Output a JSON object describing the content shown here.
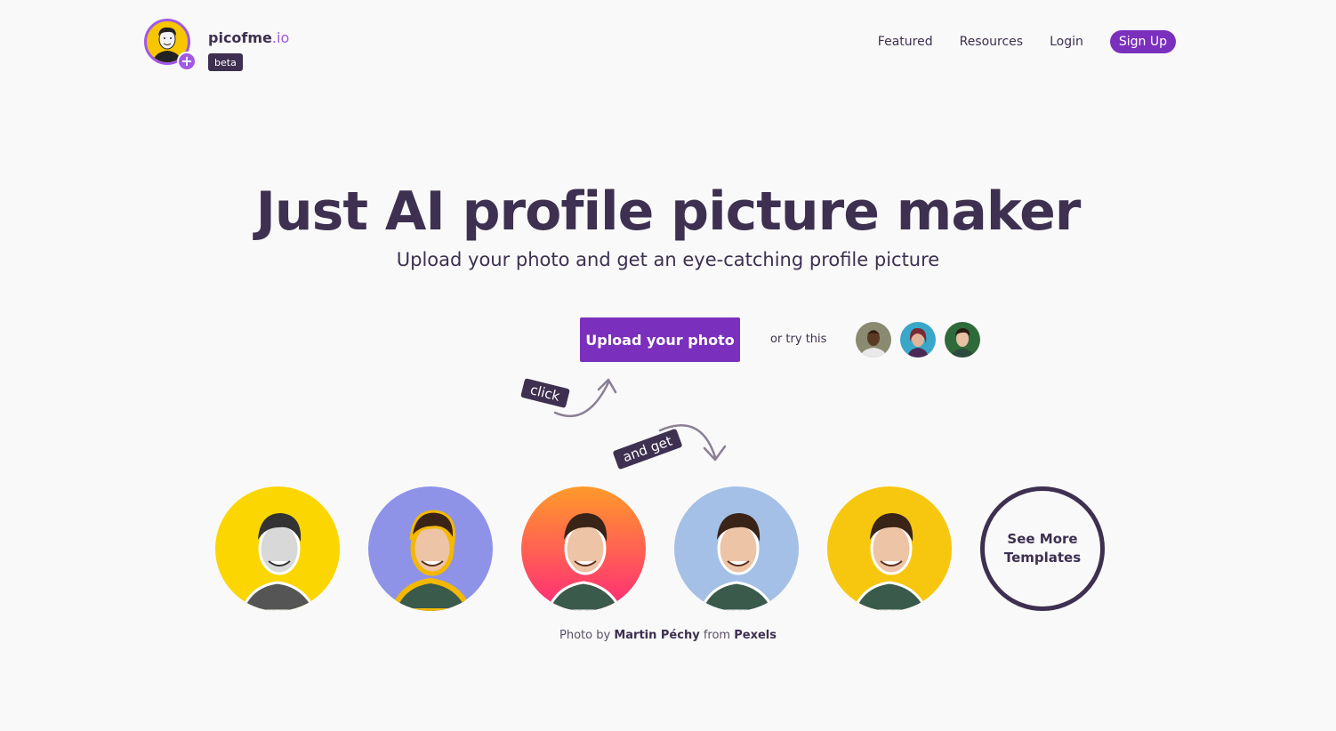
{
  "header": {
    "brand_name": "picofme",
    "brand_tld": ".io",
    "badge": "beta",
    "nav": {
      "featured": "Featured",
      "resources": "Resources",
      "login": "Login",
      "signup": "Sign Up"
    }
  },
  "hero": {
    "title": "Just AI profile picture maker",
    "subtitle": "Upload your photo and get an eye-catching profile picture",
    "upload_label": "Upload your photo",
    "try_label": "or try this",
    "click_tag": "click",
    "and_get_tag": "and get"
  },
  "templates": {
    "see_more": "See More Templates"
  },
  "credit": {
    "prefix": "Photo by",
    "author": "Martin Péchy",
    "middle": "from",
    "source": "Pexels"
  },
  "colors": {
    "brand_purple": "#7b2fbd",
    "dark_text": "#3d3050",
    "accent_purple": "#a159e6"
  }
}
